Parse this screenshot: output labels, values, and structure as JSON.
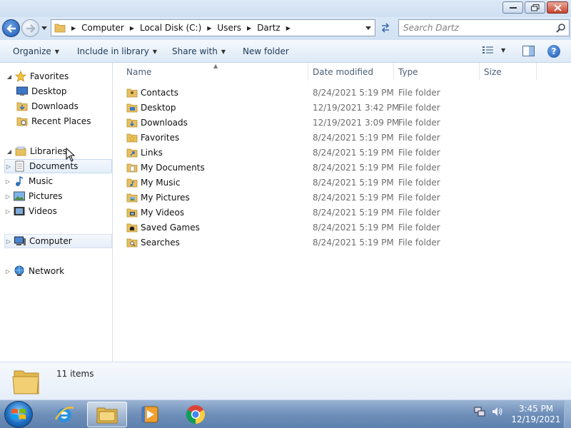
{
  "address": {
    "crumbs": [
      "Computer",
      "Local Disk (C:)",
      "Users",
      "Dartz"
    ]
  },
  "search": {
    "placeholder": "Search Dartz"
  },
  "commands": {
    "organize": "Organize",
    "include": "Include in library",
    "share": "Share with",
    "newfolder": "New folder"
  },
  "nav": {
    "favorites": "Favorites",
    "desktop": "Desktop",
    "downloads": "Downloads",
    "recent": "Recent Places",
    "libraries": "Libraries",
    "documents": "Documents",
    "music": "Music",
    "pictures": "Pictures",
    "videos": "Videos",
    "computer": "Computer",
    "network": "Network"
  },
  "columns": {
    "name": "Name",
    "date": "Date modified",
    "type": "Type",
    "size": "Size"
  },
  "files": [
    {
      "name": "Contacts",
      "date": "8/24/2021 5:19 PM",
      "type": "File folder"
    },
    {
      "name": "Desktop",
      "date": "12/19/2021 3:42 PM",
      "type": "File folder"
    },
    {
      "name": "Downloads",
      "date": "12/19/2021 3:09 PM",
      "type": "File folder"
    },
    {
      "name": "Favorites",
      "date": "8/24/2021 5:19 PM",
      "type": "File folder"
    },
    {
      "name": "Links",
      "date": "8/24/2021 5:19 PM",
      "type": "File folder"
    },
    {
      "name": "My Documents",
      "date": "8/24/2021 5:19 PM",
      "type": "File folder"
    },
    {
      "name": "My Music",
      "date": "8/24/2021 5:19 PM",
      "type": "File folder"
    },
    {
      "name": "My Pictures",
      "date": "8/24/2021 5:19 PM",
      "type": "File folder"
    },
    {
      "name": "My Videos",
      "date": "8/24/2021 5:19 PM",
      "type": "File folder"
    },
    {
      "name": "Saved Games",
      "date": "8/24/2021 5:19 PM",
      "type": "File folder"
    },
    {
      "name": "Searches",
      "date": "8/24/2021 5:19 PM",
      "type": "File folder"
    }
  ],
  "details": {
    "count": "11 items"
  },
  "clock": {
    "time": "3:45 PM",
    "date": "12/19/2021"
  },
  "taskbar": {
    "icons": [
      "start-orb-icon",
      "internet-explorer-icon",
      "file-explorer-icon",
      "media-player-icon",
      "chrome-icon"
    ]
  },
  "colors": {
    "accent": "#1e57b2",
    "folder": "#e8c060",
    "taskbar": "#6e8fb9"
  }
}
